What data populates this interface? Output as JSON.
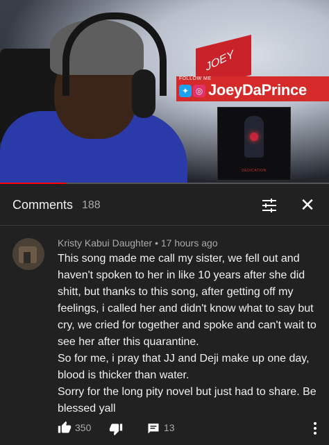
{
  "video": {
    "sign_text": "JOEY",
    "follow_label": "FOLLOW ME",
    "channel_name": "JoeyDaPrince",
    "social_icons": [
      "twitter-icon",
      "instagram-icon"
    ],
    "album_text": "DEDICATION",
    "progress": 0.2
  },
  "comments_header": {
    "title": "Comments",
    "count": "188",
    "filter_icon": "sort-filter-icon",
    "close_icon": "close-icon"
  },
  "comment": {
    "author": "Kristy Kabui Daughter",
    "separator": "•",
    "time": "17 hours ago",
    "paragraphs": [
      "This song made me call my sister, we fell out and haven't spoken to her in like 10 years after she did shitt, but thanks to this song, after getting off my feelings, i called her and didn't know what to say but cry, we cried for together and spoke and can't wait to see her after this quarantine.",
      "So for me, i pray that JJ and Deji make up one day, blood is thicker than water.",
      "Sorry for the long pity novel but just had to share. Be blessed yall"
    ],
    "likes": "350",
    "replies": "13"
  },
  "colors": {
    "background": "#212121",
    "text_primary": "#f1f1f1",
    "text_secondary": "#aaaaaa",
    "progress": "#ff0000",
    "banner": "#d42a2a"
  }
}
